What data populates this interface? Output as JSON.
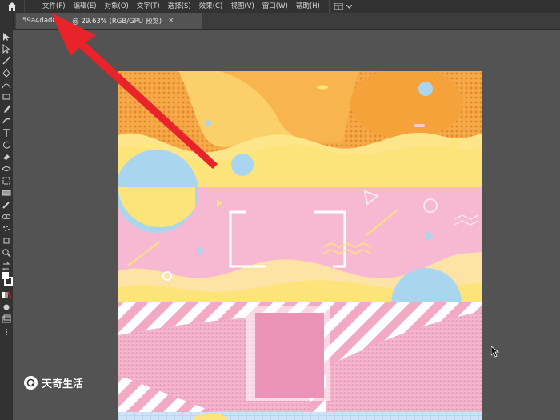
{
  "menubar": {
    "items": [
      "文件(F)",
      "编辑(E)",
      "对象(O)",
      "文字(T)",
      "选择(S)",
      "效果(C)",
      "视图(V)",
      "窗口(W)",
      "帮助(H)"
    ]
  },
  "document_tab": {
    "name": "59a4dad85",
    "zoom_mode": "@ 29.63% (RGB/GPU 预览)",
    "close": "×"
  },
  "watermark": {
    "text": "天奇生活"
  },
  "colors": {
    "app_bg": "#535353",
    "panel_bg": "#323232",
    "accent_red": "#e8232a",
    "orange": "#f6a94a",
    "yellow": "#fde47a",
    "pink": "#f7b9d2",
    "rose": "#ea93b6"
  },
  "icons": {
    "home": "home-icon",
    "arrow": "red-pointer-arrow",
    "cursor": "mouse-pointer-icon"
  }
}
